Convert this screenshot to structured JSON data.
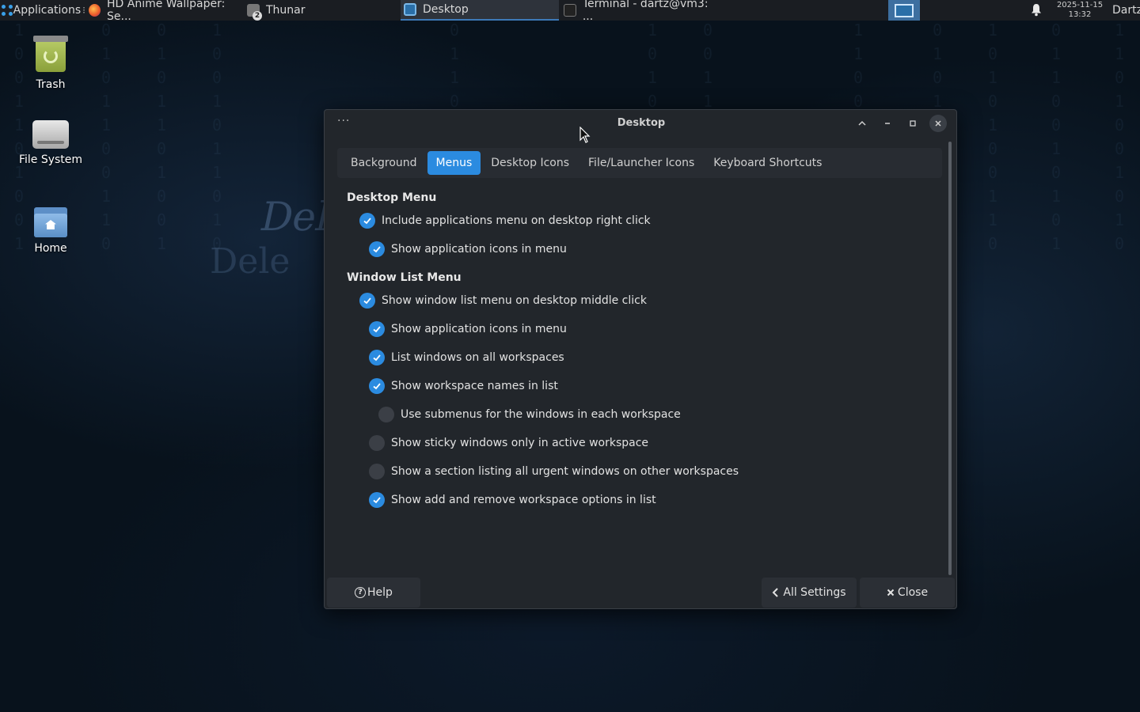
{
  "panel": {
    "applications_label": "Applications",
    "tasks": [
      {
        "label": "HD Anime Wallpaper: Se..."
      },
      {
        "label": "Thunar",
        "badge": "2"
      },
      {
        "label": "Desktop"
      },
      {
        "label": "Terminal - dartz@vm3: ..."
      }
    ],
    "clock_date": "2025-11-15",
    "clock_time": "13:32",
    "user": "Dartz"
  },
  "desktop_icons": [
    {
      "label": "Trash"
    },
    {
      "label": "File System"
    },
    {
      "label": "Home"
    }
  ],
  "dialog": {
    "title": "Desktop",
    "tabs": [
      "Background",
      "Menus",
      "Desktop Icons",
      "File/Launcher Icons",
      "Keyboard Shortcuts"
    ],
    "active_tab": "Menus",
    "desktop_menu": {
      "title": "Desktop Menu",
      "options": [
        {
          "label": "Include applications menu on desktop right click",
          "checked": true
        },
        {
          "label": "Show application icons in menu",
          "checked": true
        }
      ]
    },
    "window_list_menu": {
      "title": "Window List Menu",
      "options": [
        {
          "label": "Show window list menu on desktop middle click",
          "checked": true
        },
        {
          "label": "Show application icons in menu",
          "checked": true
        },
        {
          "label": "List windows on all workspaces",
          "checked": true
        },
        {
          "label": "Show workspace names in list",
          "checked": true
        },
        {
          "label": "Use submenus for the windows in each workspace",
          "checked": false
        },
        {
          "label": "Show sticky windows only in active workspace",
          "checked": false
        },
        {
          "label": "Show a section listing all urgent windows on other workspaces",
          "checked": false
        },
        {
          "label": "Show add and remove workspace options in list",
          "checked": true
        }
      ]
    },
    "buttons": {
      "help": "Help",
      "all_settings": "All Settings",
      "close": "Close"
    }
  },
  "colors": {
    "accent": "#2b8be0",
    "dialog_bg": "#22262b",
    "panel_bg": "#1a1d22"
  }
}
